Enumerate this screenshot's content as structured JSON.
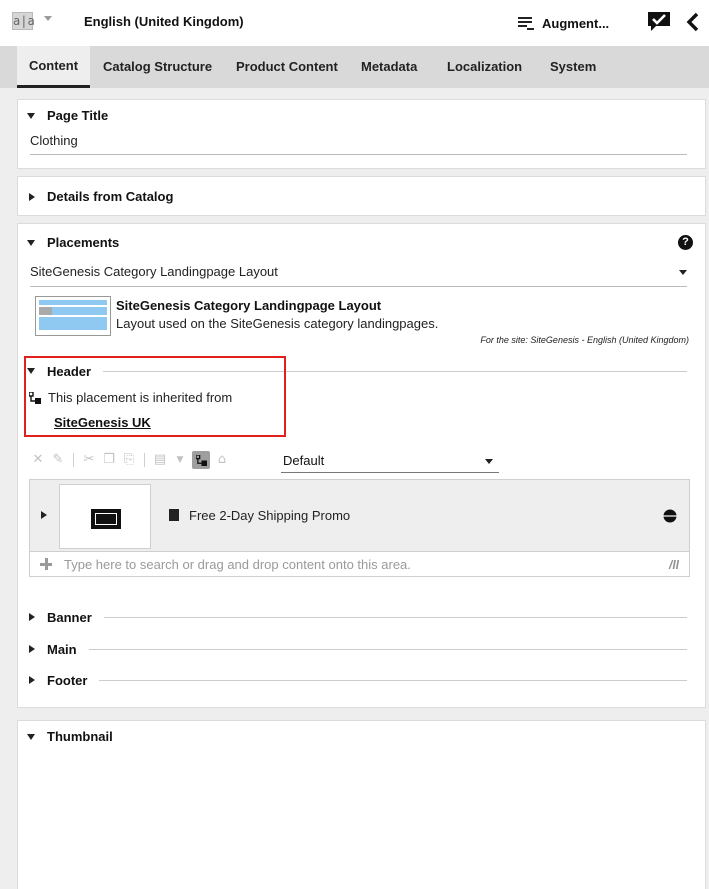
{
  "topbar": {
    "language_icon_glyph": "a|a",
    "language_label": "English (United Kingdom)",
    "augment_label": "Augment...",
    "icons": [
      "language-icon",
      "chevron-down-icon",
      "augment-icon",
      "chat-check-icon",
      "back-icon"
    ]
  },
  "tabs": [
    {
      "label": "Content",
      "active": true
    },
    {
      "label": "Catalog Structure",
      "active": false
    },
    {
      "label": "Product Content",
      "active": false
    },
    {
      "label": "Metadata",
      "active": false
    },
    {
      "label": "Localization",
      "active": false
    },
    {
      "label": "System",
      "active": false
    }
  ],
  "page_title": {
    "heading": "Page Title",
    "value": "Clothing"
  },
  "details": {
    "heading": "Details from Catalog"
  },
  "placements": {
    "heading": "Placements",
    "help_glyph": "?",
    "layout_select": "SiteGenesis Category Landingpage Layout",
    "layout_name": "SiteGenesis Category Landingpage Layout",
    "layout_description": "Layout used on the SiteGenesis category landingpages.",
    "layout_site_note": "For the site: SiteGenesis - English (United Kingdom)",
    "header": {
      "label": "Header",
      "inherited_text": "This placement is inherited from",
      "inherited_link": "SiteGenesis UK",
      "variant_select": "Default",
      "item_title": "Free 2-Day Shipping Promo",
      "drop_placeholder": "Type here to search or drag and drop content onto this area.",
      "library_glyph": "/ll"
    },
    "other_sections": [
      "Banner",
      "Main",
      "Footer"
    ]
  },
  "thumbnail": {
    "heading": "Thumbnail"
  },
  "colors": {
    "highlight": "#e1201b",
    "tabbar": "#d9d9d9",
    "layout_blue": "#8fc8f0"
  }
}
